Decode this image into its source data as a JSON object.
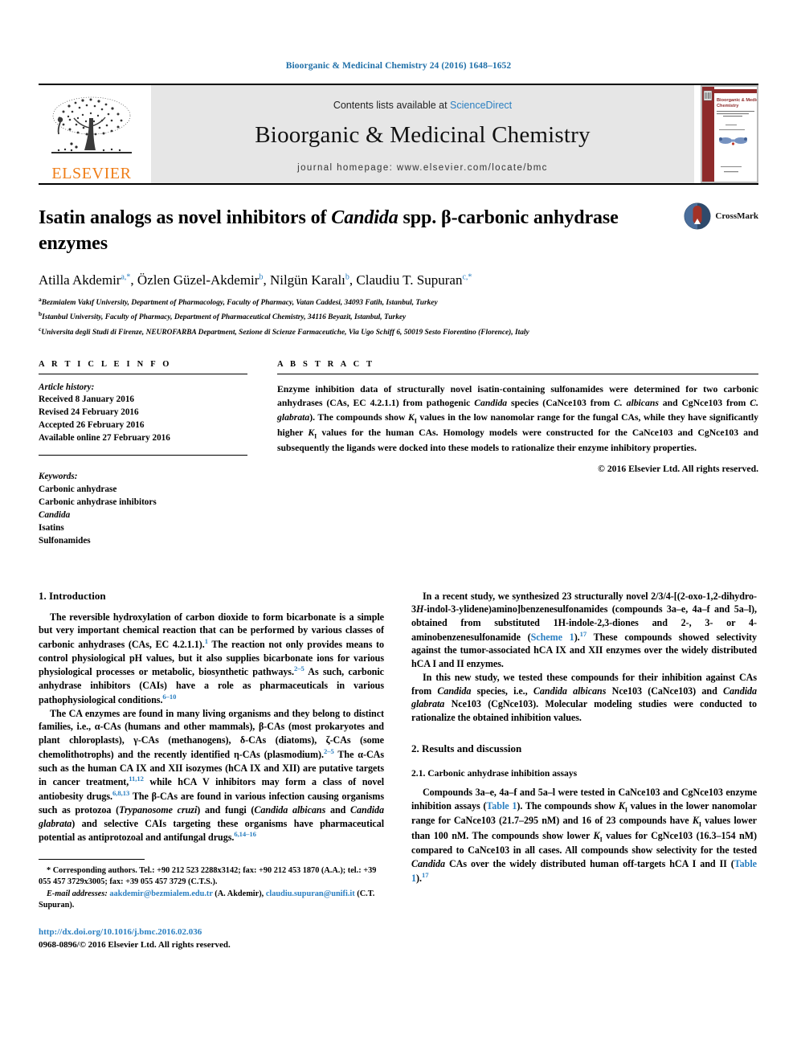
{
  "running_head": "Bioorganic & Medicinal Chemistry 24 (2016) 1648–1652",
  "masthead": {
    "contents_prefix": "Contents lists available at ",
    "sciencedirect": "ScienceDirect",
    "journal_title": "Bioorganic & Medicinal Chemistry",
    "homepage": "journal homepage: www.elsevier.com/locate/bmc",
    "publisher_logo_word": "ELSEVIER",
    "cover": {
      "title_line1": "Bioorganic & Medicinal",
      "title_line2": "Chemistry"
    }
  },
  "title": {
    "part1": "Isatin analogs as novel inhibitors of ",
    "italic": "Candida",
    "part2": " spp. β-carbonic anhydrase enzymes",
    "crossmark_label": "CrossMark"
  },
  "authors": {
    "a1": "Atilla Akdemir",
    "a1_sup": "a,*",
    "a2": "Özlen Güzel-Akdemir",
    "a2_sup": "b",
    "a3": "Nilgün Karalı",
    "a3_sup": "b",
    "a4": "Claudiu T. Supuran",
    "a4_sup": "c,*",
    "sep": ", "
  },
  "affiliations": [
    {
      "marker": "a",
      "text": "Bezmialem Vakıf University, Department of Pharmacology, Faculty of Pharmacy, Vatan Caddesi, 34093 Fatih, Istanbul, Turkey"
    },
    {
      "marker": "b",
      "text": "Istanbul University, Faculty of Pharmacy, Department of Pharmaceutical Chemistry, 34116 Beyazit, Istanbul, Turkey"
    },
    {
      "marker": "c",
      "text": "Universita degli Studi di Firenze, NEUROFARBA Department, Sezione di Scienze Farmaceutiche, Via Ugo Schiff 6, 50019 Sesto Fiorentino (Florence), Italy"
    }
  ],
  "article_info": {
    "heading": "A R T I C L E   I N F O",
    "history_label": "Article history:",
    "history": [
      "Received 8 January 2016",
      "Revised 24 February 2016",
      "Accepted 26 February 2016",
      "Available online 27 February 2016"
    ],
    "keywords_label": "Keywords:",
    "keywords": [
      "Carbonic anhydrase",
      "Carbonic anhydrase inhibitors",
      "Candida",
      "Isatins",
      "Sulfonamides"
    ]
  },
  "abstract": {
    "heading": "A B S T R A C T",
    "s1": "Enzyme inhibition data of structurally novel isatin-containing sulfonamides were determined for two carbonic anhydrases (CAs, EC 4.2.1.1) from pathogenic ",
    "i1": "Candida",
    "s2": " species (CaNce103 from ",
    "i2": "C. albicans",
    "s3": " and CgNce103 from ",
    "i3": "C. glabrata",
    "s4": "). The compounds show ",
    "k1": "K",
    "k1sub": "I",
    "s5": " values in the low nanomolar range for the fungal CAs, while they have significantly higher ",
    "k2": "K",
    "k2sub": "I",
    "s6": " values for the human CAs. Homology models were constructed for the CaNce103 and CgNce103 and subsequently the ligands were docked into these models to rationalize their enzyme inhibitory properties.",
    "copyright": "© 2016 Elsevier Ltd. All rights reserved."
  },
  "sections": {
    "intro_heading": "1. Introduction",
    "results_heading": "2. Results and discussion",
    "assays_heading": "2.1. Carbonic anhydrase inhibition assays"
  },
  "intro": {
    "p1_a": "The reversible hydroxylation of carbon dioxide to form bicarbonate is a simple but very important chemical reaction that can be performed by various classes of carbonic anhydrases (CAs, EC 4.2.1.1).",
    "p1_r1": "1",
    "p1_b": " The reaction not only provides means to control physiological pH values, but it also supplies bicarbonate ions for various physiological processes or metabolic, biosynthetic pathways.",
    "p1_r2": "2–5",
    "p1_c": " As such, carbonic anhydrase inhibitors (CAIs) have a role as pharmaceuticals in various pathophysiological conditions.",
    "p1_r3": "6–10",
    "p2_a": "The CA enzymes are found in many living organisms and they belong to distinct families, i.e., α-CAs (humans and other mammals), β-CAs (most prokaryotes and plant chloroplasts), γ-CAs (methanogens), δ-CAs (diatoms), ζ-CAs (some chemolithotrophs) and the recently identified η-CAs (plasmodium).",
    "p2_r1": "2–5",
    "p2_b": " The α-CAs such as the human CA IX and XII isozymes (hCA IX and XII) are putative targets in cancer treatment,",
    "p2_r2": "11,12",
    "p2_c": " while hCA V inhibitors may form a class of novel antiobesity drugs.",
    "p2_r3": "6,8,13",
    "p2_d": " The β-CAs are found in various infection causing organisms such as protozoa (",
    "p2_i1": "Trypanosome cruzi",
    "p2_e": ") and fungi (",
    "p2_i2": "Candida albicans",
    "p2_f": " and ",
    "p2_i3": "Candida glabrata",
    "p2_g": ") and selective CAIs targeting these organisms have pharmaceutical potential as antiprotozoal and antifungal drugs.",
    "p2_r4": "6,14–16"
  },
  "right_col": {
    "p1_a": "In a recent study, we synthesized 23 structurally novel 2/3/4-[(2-oxo-1,2-dihydro-3",
    "p1_i1": "H",
    "p1_b": "-indol-3-ylidene)amino]benzenesulfonamides (compounds ",
    "p1_b1": "3a–e",
    "p1_c": ", ",
    "p1_b2": "4a–f",
    "p1_d": " and ",
    "p1_b3": "5a–l",
    "p1_e": "), obtained from substituted 1H-indole-2,3-diones and 2-, 3- or 4-aminobenzenesulfonamide (",
    "p1_link": "Scheme 1",
    "p1_f": ").",
    "p1_r1": "17",
    "p1_g": " These compounds showed selectivity against the tumor-associated hCA IX and XII enzymes over the widely distributed hCA I and II enzymes.",
    "p2_a": "In this new study, we tested these compounds for their inhibition against CAs from ",
    "p2_i1": "Candida",
    "p2_b": " species, i.e., ",
    "p2_i2": "Candida albicans",
    "p2_c": " Nce103 (CaNce103) and ",
    "p2_i3": "Candida glabrata",
    "p2_d": " Nce103 (CgNce103). Molecular modeling studies were conducted to rationalize the obtained inhibition values.",
    "p3_a": "Compounds ",
    "p3_b1": "3a–e",
    "p3_b": ", ",
    "p3_b2": "4a–f",
    "p3_c": " and ",
    "p3_b3": "5a–l",
    "p3_d": " were tested in CaNce103 and CgNce103 enzyme inhibition assays (",
    "p3_link1": "Table 1",
    "p3_e": "). The compounds show ",
    "p3_k1": "K",
    "p3_k1s": "I",
    "p3_f": " values in the lower nanomolar range for CaNce103 (21.7–295 nM) and 16 of 23 compounds have ",
    "p3_k2": "K",
    "p3_k2s": "I",
    "p3_g": " values lower than 100 nM. The compounds show lower ",
    "p3_k3": "K",
    "p3_k3s": "I",
    "p3_h": " values for CgNce103 (16.3–154 nM) compared to CaNce103 in all cases. All compounds show selectivity for the tested ",
    "p3_i1": "Candida",
    "p3_i": " CAs over the widely distributed human off-targets hCA I and II (",
    "p3_link2": "Table 1",
    "p3_j": ").",
    "p3_r1": "17"
  },
  "footnote": {
    "line1": "* Corresponding authors. Tel.: +90 212 523 2288x3142; fax: +90 212 453 1870 (A.A.); tel.: +39 055 457 3729x3005; fax: +39 055 457 3729 (C.T.S.).",
    "email_label": "E-mail addresses:",
    "email1": "aakdemir@bezmialem.edu.tr",
    "email1_owner": " (A. Akdemir), ",
    "email2": "claudiu.supuran@unifi.it",
    "email2_owner": " (C.T. Supuran)."
  },
  "footer": {
    "doi": "http://dx.doi.org/10.1016/j.bmc.2016.02.036",
    "issn": "0968-0896/© 2016 Elsevier Ltd. All rights reserved."
  },
  "colors": {
    "link_blue": "#2a7fc1",
    "elsevier_orange": "#ef7d17",
    "masthead_gray": "#e6e6e6",
    "cover_maroon": "#8e2b2b"
  }
}
